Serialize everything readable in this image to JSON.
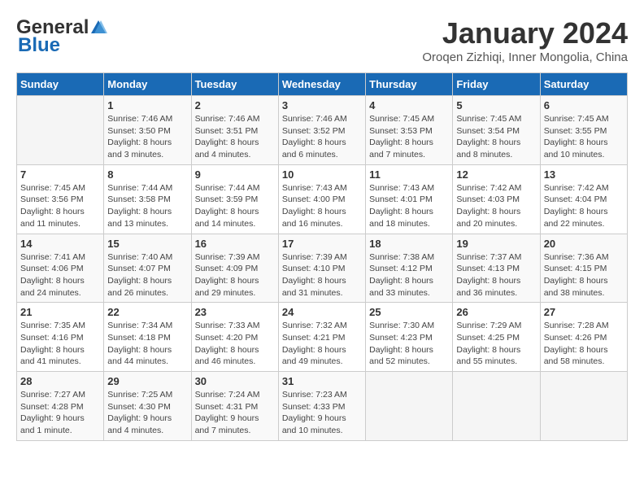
{
  "logo": {
    "general": "General",
    "blue": "Blue"
  },
  "title": "January 2024",
  "subtitle": "Oroqen Zizhiqi, Inner Mongolia, China",
  "days_of_week": [
    "Sunday",
    "Monday",
    "Tuesday",
    "Wednesday",
    "Thursday",
    "Friday",
    "Saturday"
  ],
  "weeks": [
    [
      {
        "day": "",
        "sunrise": "",
        "sunset": "",
        "daylight": ""
      },
      {
        "day": "1",
        "sunrise": "Sunrise: 7:46 AM",
        "sunset": "Sunset: 3:50 PM",
        "daylight": "Daylight: 8 hours and 3 minutes."
      },
      {
        "day": "2",
        "sunrise": "Sunrise: 7:46 AM",
        "sunset": "Sunset: 3:51 PM",
        "daylight": "Daylight: 8 hours and 4 minutes."
      },
      {
        "day": "3",
        "sunrise": "Sunrise: 7:46 AM",
        "sunset": "Sunset: 3:52 PM",
        "daylight": "Daylight: 8 hours and 6 minutes."
      },
      {
        "day": "4",
        "sunrise": "Sunrise: 7:45 AM",
        "sunset": "Sunset: 3:53 PM",
        "daylight": "Daylight: 8 hours and 7 minutes."
      },
      {
        "day": "5",
        "sunrise": "Sunrise: 7:45 AM",
        "sunset": "Sunset: 3:54 PM",
        "daylight": "Daylight: 8 hours and 8 minutes."
      },
      {
        "day": "6",
        "sunrise": "Sunrise: 7:45 AM",
        "sunset": "Sunset: 3:55 PM",
        "daylight": "Daylight: 8 hours and 10 minutes."
      }
    ],
    [
      {
        "day": "7",
        "sunrise": "Sunrise: 7:45 AM",
        "sunset": "Sunset: 3:56 PM",
        "daylight": "Daylight: 8 hours and 11 minutes."
      },
      {
        "day": "8",
        "sunrise": "Sunrise: 7:44 AM",
        "sunset": "Sunset: 3:58 PM",
        "daylight": "Daylight: 8 hours and 13 minutes."
      },
      {
        "day": "9",
        "sunrise": "Sunrise: 7:44 AM",
        "sunset": "Sunset: 3:59 PM",
        "daylight": "Daylight: 8 hours and 14 minutes."
      },
      {
        "day": "10",
        "sunrise": "Sunrise: 7:43 AM",
        "sunset": "Sunset: 4:00 PM",
        "daylight": "Daylight: 8 hours and 16 minutes."
      },
      {
        "day": "11",
        "sunrise": "Sunrise: 7:43 AM",
        "sunset": "Sunset: 4:01 PM",
        "daylight": "Daylight: 8 hours and 18 minutes."
      },
      {
        "day": "12",
        "sunrise": "Sunrise: 7:42 AM",
        "sunset": "Sunset: 4:03 PM",
        "daylight": "Daylight: 8 hours and 20 minutes."
      },
      {
        "day": "13",
        "sunrise": "Sunrise: 7:42 AM",
        "sunset": "Sunset: 4:04 PM",
        "daylight": "Daylight: 8 hours and 22 minutes."
      }
    ],
    [
      {
        "day": "14",
        "sunrise": "Sunrise: 7:41 AM",
        "sunset": "Sunset: 4:06 PM",
        "daylight": "Daylight: 8 hours and 24 minutes."
      },
      {
        "day": "15",
        "sunrise": "Sunrise: 7:40 AM",
        "sunset": "Sunset: 4:07 PM",
        "daylight": "Daylight: 8 hours and 26 minutes."
      },
      {
        "day": "16",
        "sunrise": "Sunrise: 7:39 AM",
        "sunset": "Sunset: 4:09 PM",
        "daylight": "Daylight: 8 hours and 29 minutes."
      },
      {
        "day": "17",
        "sunrise": "Sunrise: 7:39 AM",
        "sunset": "Sunset: 4:10 PM",
        "daylight": "Daylight: 8 hours and 31 minutes."
      },
      {
        "day": "18",
        "sunrise": "Sunrise: 7:38 AM",
        "sunset": "Sunset: 4:12 PM",
        "daylight": "Daylight: 8 hours and 33 minutes."
      },
      {
        "day": "19",
        "sunrise": "Sunrise: 7:37 AM",
        "sunset": "Sunset: 4:13 PM",
        "daylight": "Daylight: 8 hours and 36 minutes."
      },
      {
        "day": "20",
        "sunrise": "Sunrise: 7:36 AM",
        "sunset": "Sunset: 4:15 PM",
        "daylight": "Daylight: 8 hours and 38 minutes."
      }
    ],
    [
      {
        "day": "21",
        "sunrise": "Sunrise: 7:35 AM",
        "sunset": "Sunset: 4:16 PM",
        "daylight": "Daylight: 8 hours and 41 minutes."
      },
      {
        "day": "22",
        "sunrise": "Sunrise: 7:34 AM",
        "sunset": "Sunset: 4:18 PM",
        "daylight": "Daylight: 8 hours and 44 minutes."
      },
      {
        "day": "23",
        "sunrise": "Sunrise: 7:33 AM",
        "sunset": "Sunset: 4:20 PM",
        "daylight": "Daylight: 8 hours and 46 minutes."
      },
      {
        "day": "24",
        "sunrise": "Sunrise: 7:32 AM",
        "sunset": "Sunset: 4:21 PM",
        "daylight": "Daylight: 8 hours and 49 minutes."
      },
      {
        "day": "25",
        "sunrise": "Sunrise: 7:30 AM",
        "sunset": "Sunset: 4:23 PM",
        "daylight": "Daylight: 8 hours and 52 minutes."
      },
      {
        "day": "26",
        "sunrise": "Sunrise: 7:29 AM",
        "sunset": "Sunset: 4:25 PM",
        "daylight": "Daylight: 8 hours and 55 minutes."
      },
      {
        "day": "27",
        "sunrise": "Sunrise: 7:28 AM",
        "sunset": "Sunset: 4:26 PM",
        "daylight": "Daylight: 8 hours and 58 minutes."
      }
    ],
    [
      {
        "day": "28",
        "sunrise": "Sunrise: 7:27 AM",
        "sunset": "Sunset: 4:28 PM",
        "daylight": "Daylight: 9 hours and 1 minute."
      },
      {
        "day": "29",
        "sunrise": "Sunrise: 7:25 AM",
        "sunset": "Sunset: 4:30 PM",
        "daylight": "Daylight: 9 hours and 4 minutes."
      },
      {
        "day": "30",
        "sunrise": "Sunrise: 7:24 AM",
        "sunset": "Sunset: 4:31 PM",
        "daylight": "Daylight: 9 hours and 7 minutes."
      },
      {
        "day": "31",
        "sunrise": "Sunrise: 7:23 AM",
        "sunset": "Sunset: 4:33 PM",
        "daylight": "Daylight: 9 hours and 10 minutes."
      },
      {
        "day": "",
        "sunrise": "",
        "sunset": "",
        "daylight": ""
      },
      {
        "day": "",
        "sunrise": "",
        "sunset": "",
        "daylight": ""
      },
      {
        "day": "",
        "sunrise": "",
        "sunset": "",
        "daylight": ""
      }
    ]
  ]
}
